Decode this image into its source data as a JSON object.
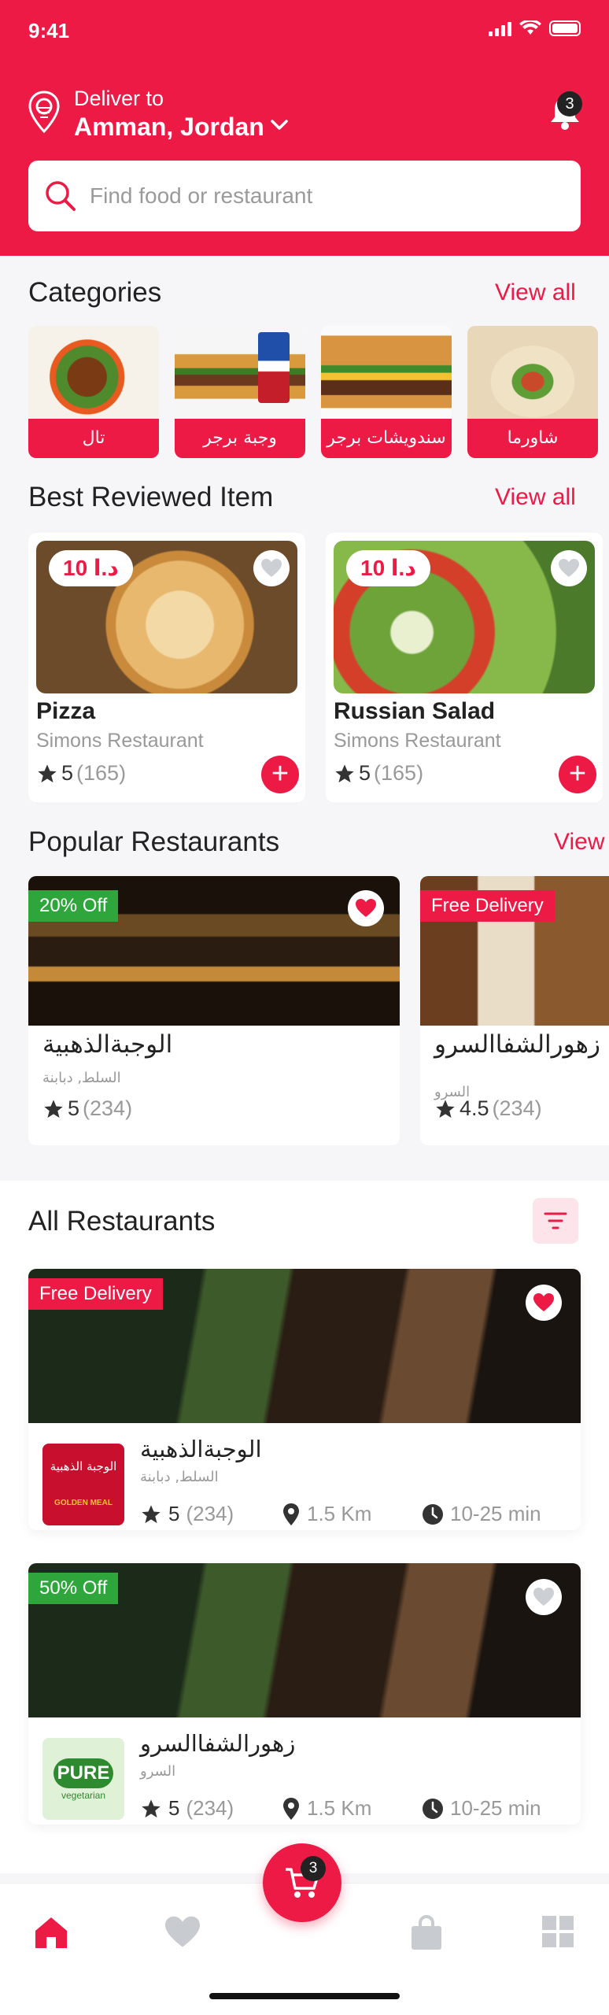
{
  "status": {
    "time": "9:41"
  },
  "header": {
    "deliver_label": "Deliver to",
    "city": "Amman, Jordan",
    "notification_count": "3"
  },
  "search": {
    "placeholder": "Find food or restaurant"
  },
  "categories": {
    "title": "Categories",
    "view_all": "View all",
    "items": [
      {
        "label": "تال"
      },
      {
        "label": "وجبة برجر"
      },
      {
        "label": "سندويشات برجر"
      },
      {
        "label": "شاورما"
      }
    ]
  },
  "best_reviewed": {
    "title": "Best Reviewed Item",
    "view_all": "View all",
    "items": [
      {
        "price": "د.ا 10",
        "name": "Pizza",
        "restaurant": "Simons Restaurant",
        "rating": "5",
        "count": "(165)"
      },
      {
        "price": "د.ا 10",
        "name": "Russian Salad",
        "restaurant": "Simons Restaurant",
        "rating": "5",
        "count": "(165)"
      }
    ]
  },
  "popular": {
    "title": "Popular Restaurants",
    "view_all": "View",
    "items": [
      {
        "tag": "20% Off",
        "name": "الوجبةالذهبية",
        "sub": "السلط, دبابنة",
        "rating": "5",
        "count": "(234)"
      },
      {
        "tag": "Free Delivery",
        "name": "زهورالشفاالسرو",
        "sub": "السرو",
        "rating": "4.5",
        "count": "(234)"
      }
    ]
  },
  "all_restaurants": {
    "title": "All Restaurants",
    "items": [
      {
        "tag": "Free Delivery",
        "name": "الوجبةالذهبية",
        "sub": "السلط, دبابنة",
        "rating": "5",
        "count": "(234)",
        "distance": "1.5 Km",
        "time": "10-25 min",
        "logo_text": "الوجبة الذهبية",
        "logo_sub": "GOLDEN MEAL"
      },
      {
        "tag": "50% Off",
        "name": "زهورالشفاالسرو",
        "sub": "السرو",
        "rating": "5",
        "count": "(234)",
        "distance": "1.5 Km",
        "time": "10-25 min",
        "logo_text": "PURE",
        "logo_sub": "vegetarian"
      }
    ]
  },
  "cart": {
    "count": "3"
  },
  "colors": {
    "accent": "#ec1a45",
    "green": "#2ea63b"
  },
  "icons": [
    "location-pin-icon",
    "chevron-down-icon",
    "bell-icon",
    "search-icon",
    "heart-icon",
    "star-icon",
    "plus-icon",
    "filter-icon",
    "pin-icon",
    "clock-icon",
    "cart-icon",
    "home-icon",
    "bag-icon",
    "grid-icon"
  ]
}
